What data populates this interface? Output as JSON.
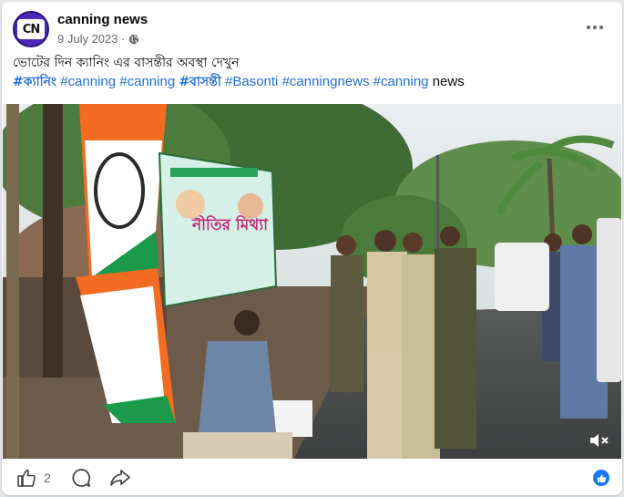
{
  "post": {
    "page_name": "canning news",
    "avatar_text": "CN",
    "date": "9 July 2023 ·",
    "caption": "ভোটের দিন ক্যানিং এর  বাসন্তীর অবস্থা দেখুন",
    "hashtags": [
      {
        "text": "#ক্যানিং",
        "bengali": true
      },
      {
        "text": "#canning",
        "bengali": false
      },
      {
        "text": "#canning",
        "bengali": false
      },
      {
        "text": "#বাসন্তী",
        "bengali": true
      },
      {
        "text": "#Basonti",
        "bengali": false
      },
      {
        "text": "#canningnews",
        "bengali": false
      },
      {
        "text": "#canning",
        "bengali": false
      }
    ],
    "trailing_word": "news"
  },
  "video": {
    "banner_text": "নীতির মিথ্যা",
    "sound": "muted"
  },
  "footer": {
    "like_count": "2"
  },
  "colors": {
    "link": "#216fdb",
    "meta": "#65676b",
    "like_blue": "#1877f2"
  },
  "icons": [
    "globe-icon",
    "more-options-icon",
    "mute-icon",
    "like-icon",
    "comment-icon",
    "share-icon",
    "like-badge-icon"
  ]
}
